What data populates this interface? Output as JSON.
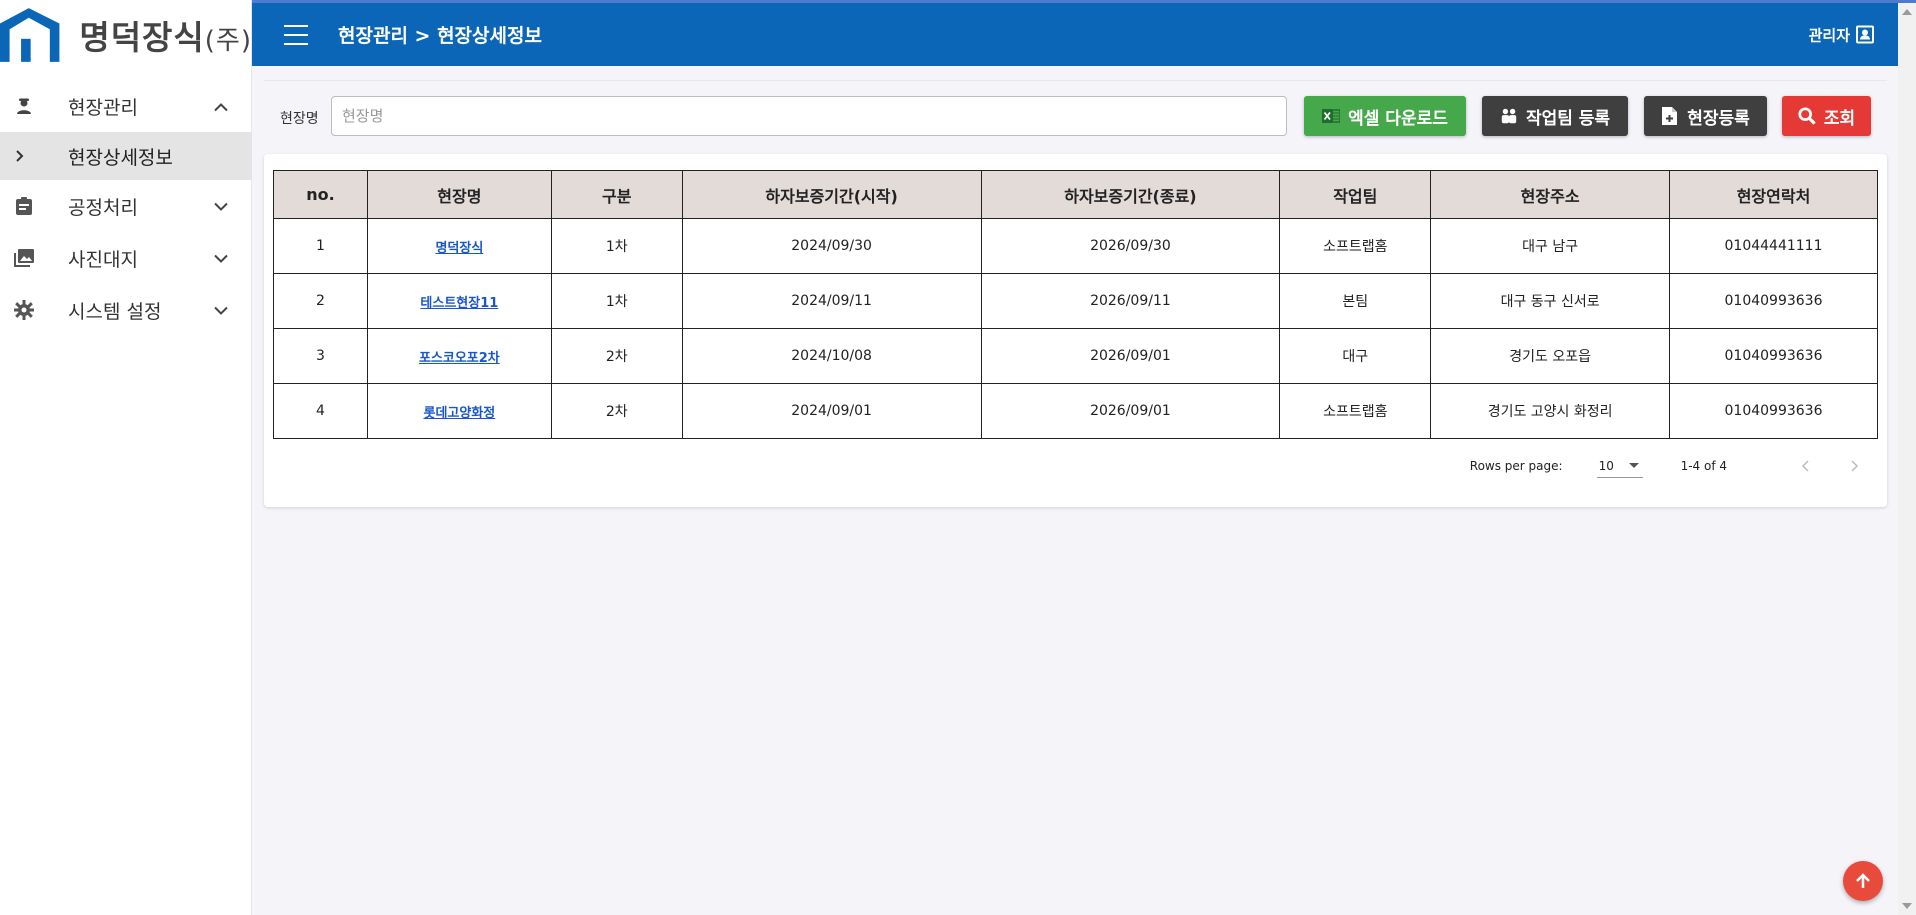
{
  "brand": {
    "name": "명덕장식",
    "suffix": "(주)"
  },
  "header": {
    "breadcrumb": "현장관리 > 현장상세정보",
    "user": "관리자"
  },
  "sidebar": {
    "items": [
      {
        "label": "현장관리",
        "icon": "worker-icon",
        "expanded": true
      },
      {
        "label": "현장상세정보",
        "icon": "chevron-right-icon",
        "sub": true
      },
      {
        "label": "공정처리",
        "icon": "clipboard-icon",
        "expanded": false
      },
      {
        "label": "사진대지",
        "icon": "photo-library-icon",
        "expanded": false
      },
      {
        "label": "시스템 설정",
        "icon": "gear-icon",
        "expanded": false
      }
    ]
  },
  "search": {
    "label": "현장명",
    "placeholder": "현장명",
    "value": ""
  },
  "buttons": {
    "excel": "엑셀 다운로드",
    "team": "작업팀 등록",
    "site": "현장등록",
    "query": "조회"
  },
  "table": {
    "headers": [
      "no.",
      "현장명",
      "구분",
      "하자보증기간(시작)",
      "하자보증기간(종료)",
      "작업팀",
      "현장주소",
      "현장연락처"
    ],
    "rows": [
      [
        "1",
        "명덕장식",
        "1차",
        "2024/09/30",
        "2026/09/30",
        "소프트랩홈",
        "대구 남구",
        "01044441111"
      ],
      [
        "2",
        "테스트현장11",
        "1차",
        "2024/09/11",
        "2026/09/11",
        "본팀",
        "대구 동구 신서로",
        "01040993636"
      ],
      [
        "3",
        "포스코오포2차",
        "2차",
        "2024/10/08",
        "2026/09/01",
        "대구",
        "경기도 오포읍",
        "01040993636"
      ],
      [
        "4",
        "롯데고양화정",
        "2차",
        "2024/09/01",
        "2026/09/01",
        "소프트랩홈",
        "경기도 고양시 화정리",
        "01040993636"
      ]
    ]
  },
  "pagination": {
    "rows_per_page_label": "Rows per page:",
    "rows_per_page": "10",
    "range": "1-4 of 4"
  },
  "colors": {
    "primary": "#0b66b7",
    "excel": "#45a84a",
    "dark": "#3f3f3f",
    "danger": "#e53935",
    "header_bg": "#e3dbd8"
  }
}
